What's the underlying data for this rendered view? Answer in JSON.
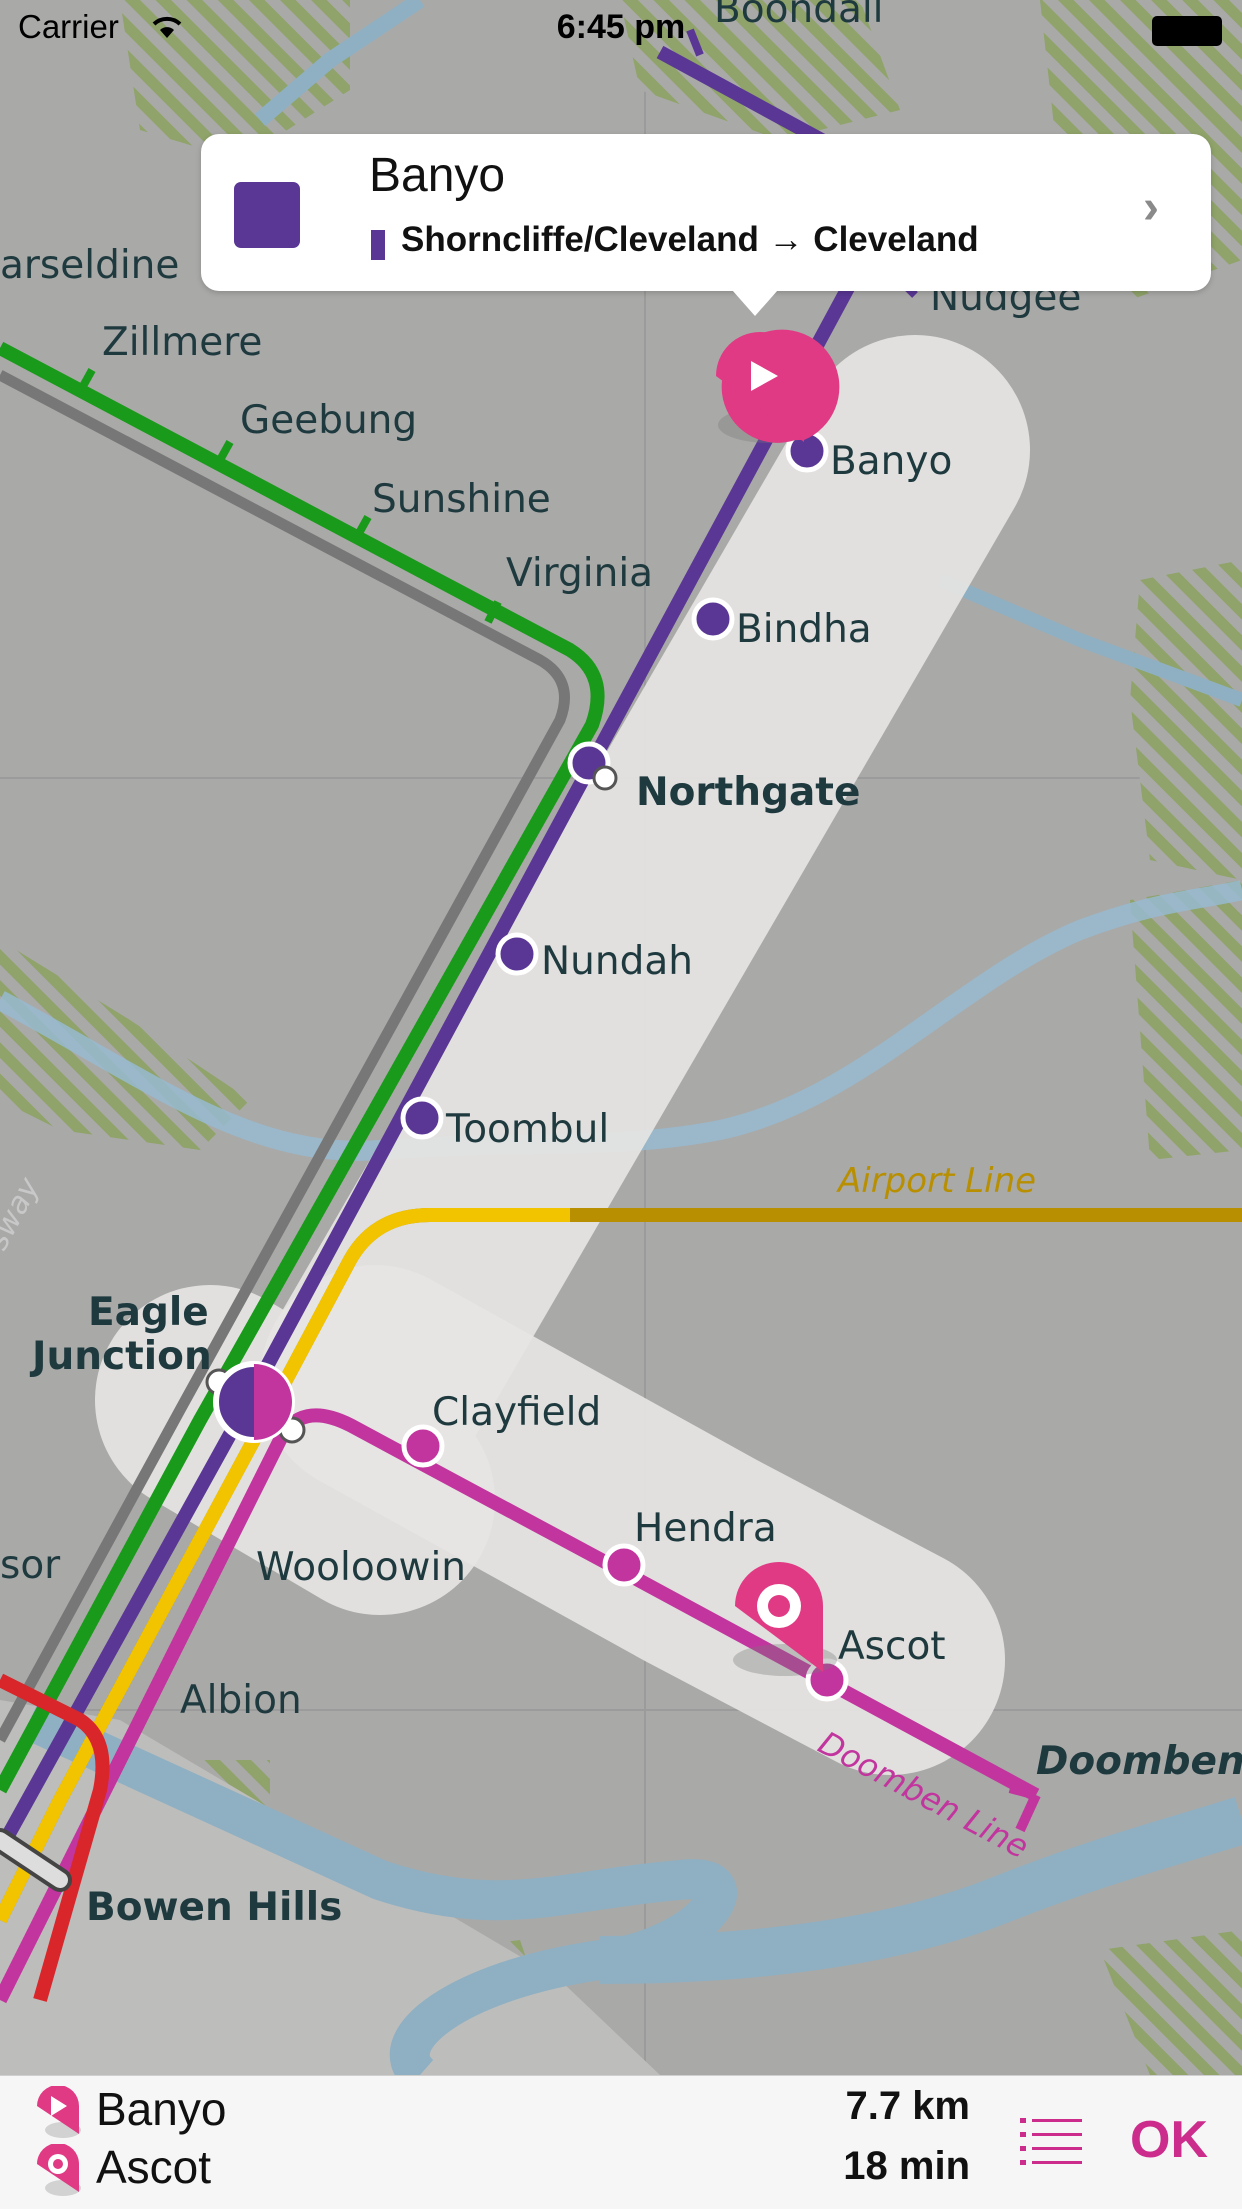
{
  "status_bar": {
    "carrier": "Carrier",
    "time": "6:45 pm"
  },
  "callout": {
    "station": "Banyo",
    "route": "Shorncliffe/Cleveland → Cleveland",
    "line_color": "#5a3794"
  },
  "map": {
    "stations": {
      "boondall": "Boondall",
      "carseldine": "arseldine",
      "zillmere": "Zillmere",
      "geebung": "Geebung",
      "sunshine": "Sunshine",
      "virginia": "Virginia",
      "nudgee": "Nudgee",
      "banyo": "Banyo",
      "bindha": "Bindha",
      "northgate": "Northgate",
      "nundah": "Nundah",
      "toombul": "Toombul",
      "eagle_junction_1": "Eagle",
      "eagle_junction_2": "Junction",
      "clayfield": "Clayfield",
      "hendra": "Hendra",
      "ascot": "Ascot",
      "doomben": "Doomben",
      "wooloowin": "Wooloowin",
      "albion": "Albion",
      "windsor": "sor",
      "bowen_hills": "Bowen Hills"
    },
    "line_labels": {
      "airport": "Airport Line",
      "doomben": "Doomben Line",
      "freeway": "sway"
    },
    "colors": {
      "shorncliffe": "#5a3794",
      "caboolture": "#1a9a1a",
      "ferny_grove": "#888888",
      "airport": "#f2c400",
      "doomben": "#c2359e",
      "red": "#d9262a",
      "highlight": "#cc2d8c"
    }
  },
  "bottom_bar": {
    "origin": "Banyo",
    "destination": "Ascot",
    "distance": "7.7 km",
    "duration": "18 min",
    "ok_label": "OK",
    "origin_icon": "origin-pin-icon",
    "destination_icon": "destination-pin-icon",
    "list_icon": "list-icon"
  }
}
